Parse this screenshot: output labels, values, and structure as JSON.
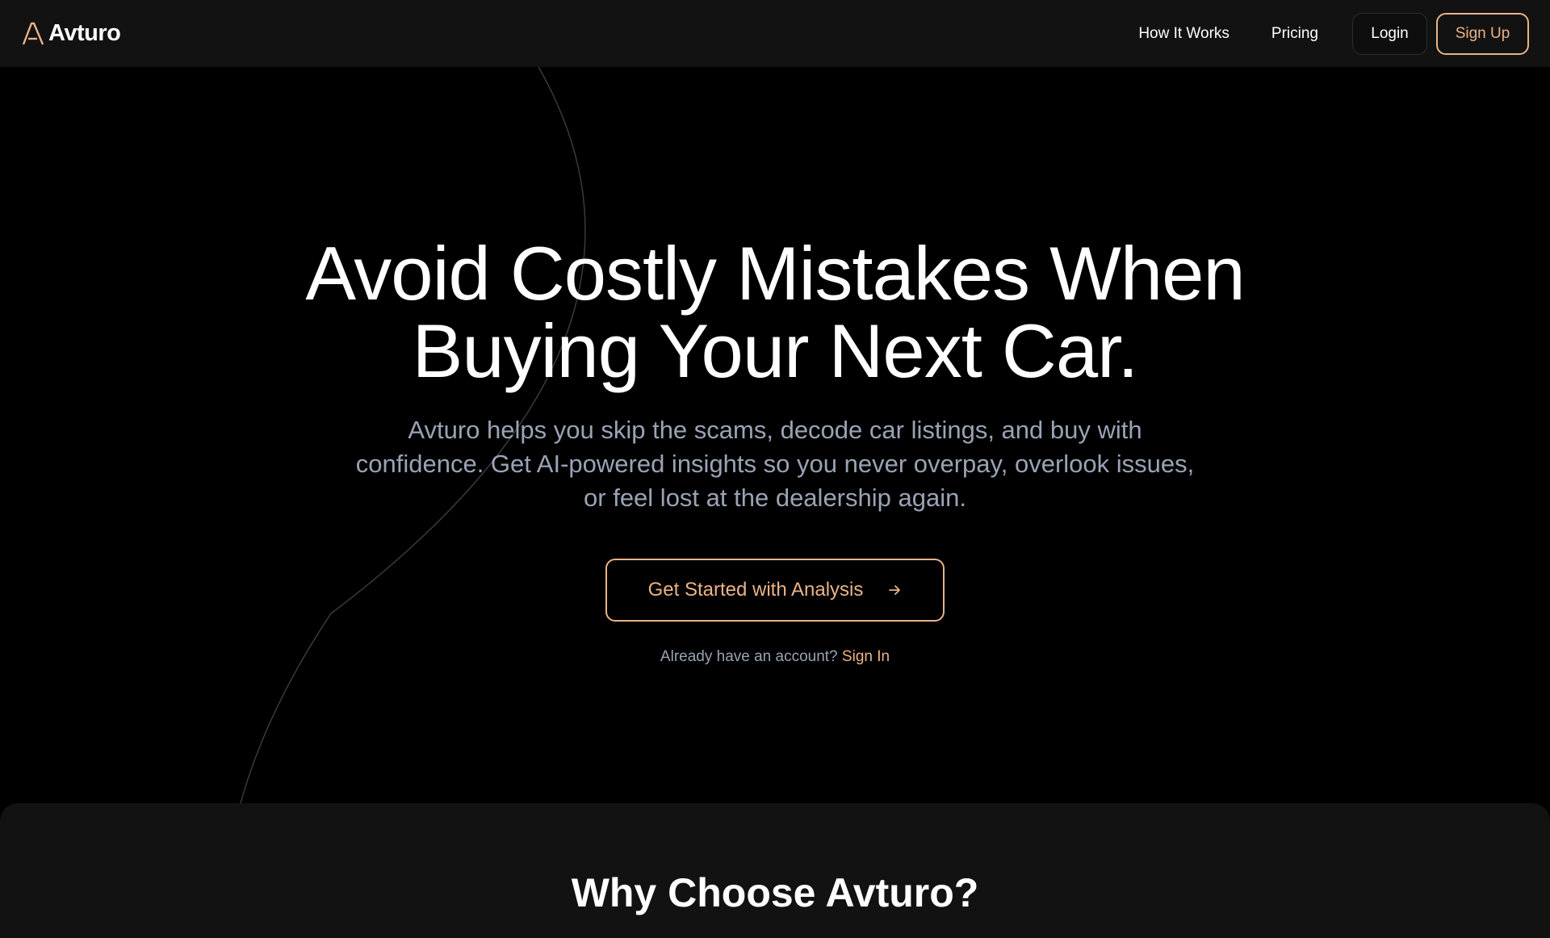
{
  "brand": {
    "name": "Avturo",
    "logo_icon": "avturo-a-logo-icon"
  },
  "nav": {
    "how_it_works": "How It Works",
    "pricing": "Pricing",
    "login": "Login",
    "sign_up": "Sign Up"
  },
  "hero": {
    "title_line1": "Avoid Costly Mistakes When",
    "title_line2": "Buying Your Next Car.",
    "subtitle": "Avturo helps you skip the scams, decode car listings, and buy with confidence. Get AI-powered insights so you never overpay, overlook issues, or feel lost at the dealership again.",
    "cta_label": "Get Started with Analysis",
    "cta_icon": "arrow-right-icon",
    "signin_prompt": "Already have an account?",
    "signin_link": "Sign In"
  },
  "why": {
    "title": "Why Choose Avturo?"
  },
  "colors": {
    "accent": "#e9b386",
    "background": "#000000",
    "header_bg": "#121212",
    "muted_text": "#9aa3b5"
  }
}
